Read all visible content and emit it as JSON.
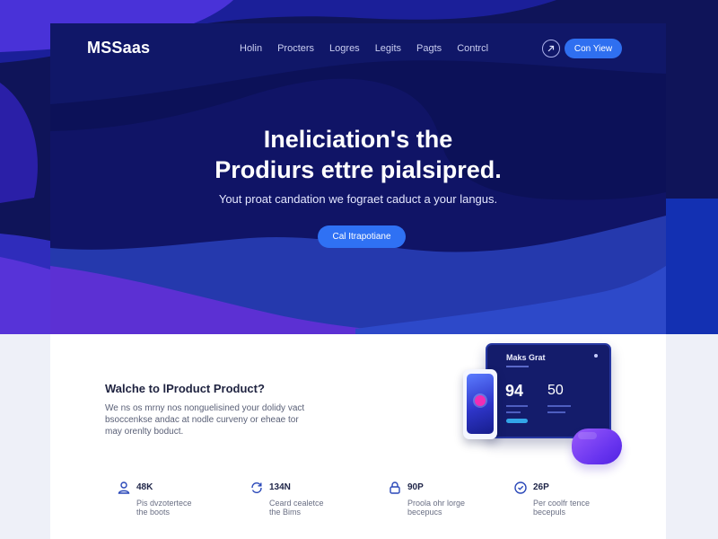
{
  "brand": {
    "logo_text": "MSSaas"
  },
  "nav": {
    "links": [
      "Holin",
      "Procters",
      "Logres",
      "Legits",
      "Pagts",
      "Contrcl"
    ],
    "cta_label": "Con Yiew"
  },
  "hero": {
    "headline_lines": [
      "Ineliciation's the",
      "Prodiurs ettre pialsipred."
    ],
    "subheadline": "Yout proat candation we fograet caduct a your langus.",
    "cta_label": "Cal Itrapotiane"
  },
  "welcome": {
    "title": "Walche to lProduct Product?",
    "body_lines": [
      "We ns os mrny nos nonguelisined your dolidy vact",
      "bsoccenkse andac at nodle curveny or eheae tor",
      "may orenlty boduct."
    ]
  },
  "stats": [
    {
      "icon": "person-icon",
      "value": "48K",
      "label_lines": [
        "Pis dvzotertece",
        "the boots"
      ]
    },
    {
      "icon": "refresh-icon",
      "value": "134N",
      "label_lines": [
        "Ceard cealetce",
        "the Bims"
      ]
    },
    {
      "icon": "lock-icon",
      "value": "90P",
      "label_lines": [
        "Proola ohr lorge",
        "becepucs"
      ]
    },
    {
      "icon": "shield-icon",
      "value": "26P",
      "label_lines": [
        "Per coolfr tence",
        "becepuls"
      ]
    }
  ],
  "mockup": {
    "tablet_title": "Maks Grat",
    "tablet_value_1": "94",
    "tablet_value_2": "50"
  },
  "colors": {
    "accent": "#2f6ff0",
    "hero_dark": "#0c1158",
    "blob_purple": "#6834ef",
    "alert_badge": "#f02db5"
  }
}
